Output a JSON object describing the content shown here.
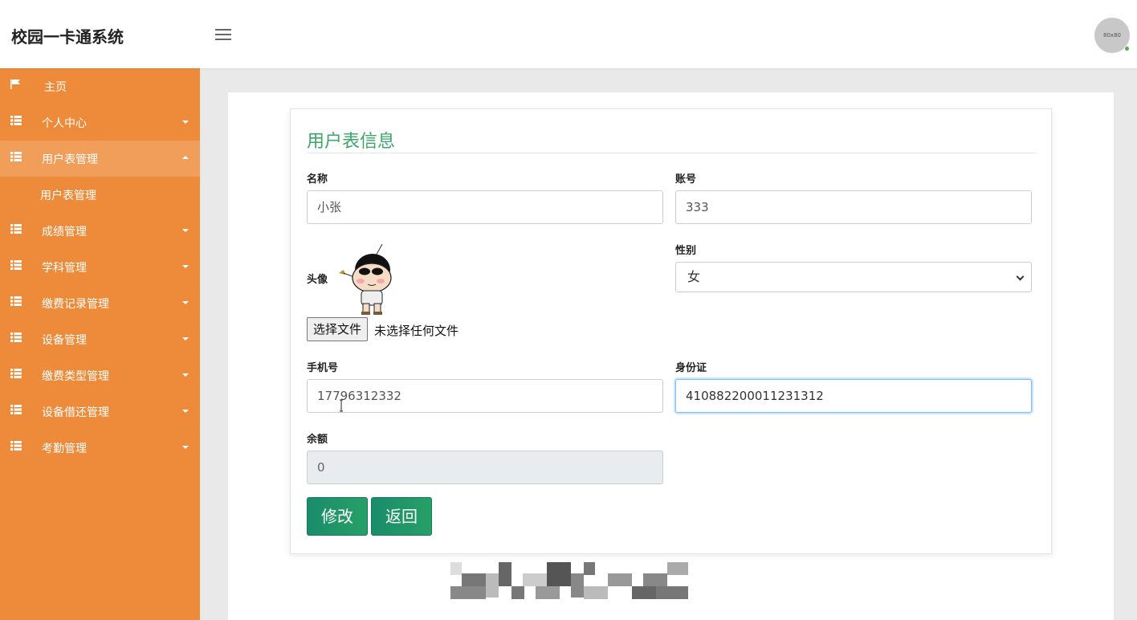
{
  "header": {
    "brand": "校园一卡通系统",
    "avatar_text": "80x80"
  },
  "sidebar": {
    "items": [
      {
        "label": "主页",
        "icon": "flag-icon"
      },
      {
        "label": "个人中心",
        "icon": "grid-icon"
      },
      {
        "label": "用户表管理",
        "icon": "grid-icon",
        "open": true,
        "sub": "用户表管理"
      },
      {
        "label": "成绩管理",
        "icon": "grid-icon"
      },
      {
        "label": "学科管理",
        "icon": "grid-icon"
      },
      {
        "label": "缴费记录管理",
        "icon": "grid-icon"
      },
      {
        "label": "设备管理",
        "icon": "grid-icon"
      },
      {
        "label": "缴费类型管理",
        "icon": "grid-icon"
      },
      {
        "label": "设备借还管理",
        "icon": "grid-icon"
      },
      {
        "label": "考勤管理",
        "icon": "grid-icon"
      }
    ]
  },
  "form": {
    "title": "用户表信息",
    "name_label": "名称",
    "name_value": "小张",
    "account_label": "账号",
    "account_value": "333",
    "avatar_label": "头像",
    "gender_label": "性别",
    "gender_value": "女",
    "file_button": "选择文件",
    "file_status": "未选择任何文件",
    "phone_label": "手机号",
    "phone_value": "17796312332",
    "id_label": "身份证",
    "id_value": "410882200011231312",
    "balance_label": "余额",
    "balance_value": "0",
    "edit_button": "修改",
    "back_button": "返回"
  },
  "colors": {
    "sidebar": "#ee8b3a",
    "accent": "#3aa66a",
    "button": "#1a8c6a"
  }
}
